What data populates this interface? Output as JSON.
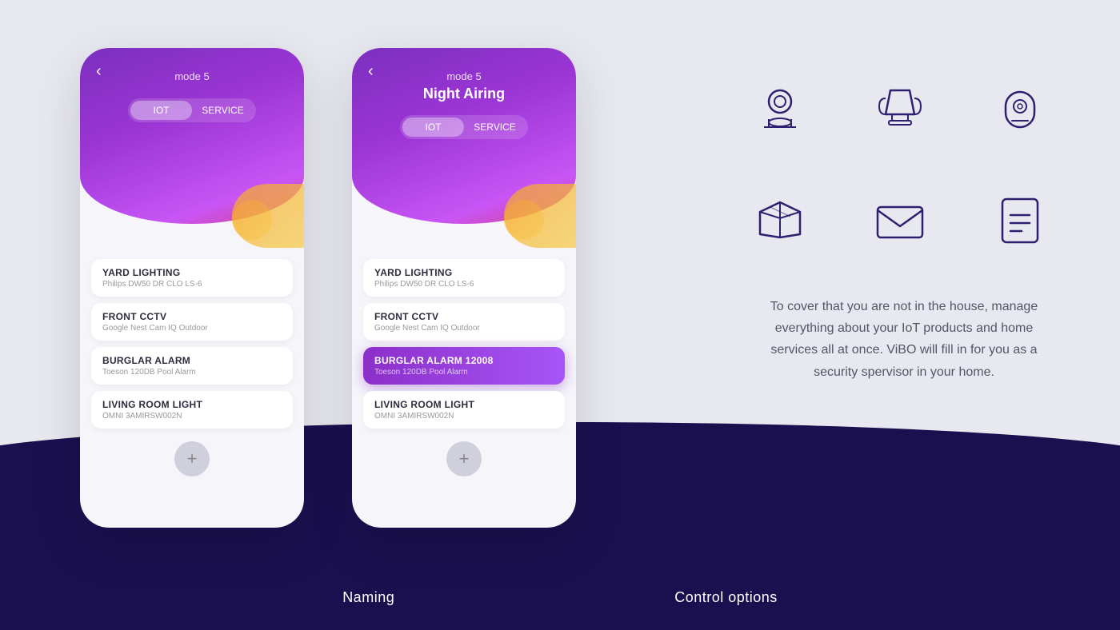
{
  "background_color": "#e8e8f0",
  "bottom_wave_color": "#1a1050",
  "phones": [
    {
      "id": "phone-naming",
      "mode_label": "mode 5",
      "mode_title": "",
      "tabs": [
        {
          "label": "IOT",
          "active": true
        },
        {
          "label": "SERVICE",
          "active": false
        }
      ],
      "devices": [
        {
          "name": "YARD LIGHTING",
          "model": "Philips DW50 DR CLO LS-6",
          "highlighted": false
        },
        {
          "name": "FRONT CCTV",
          "model": "Google Nest Cam IQ Outdoor",
          "highlighted": false
        },
        {
          "name": "BURGLAR ALARM",
          "model": "Toeson 120DB Pool Alarm",
          "highlighted": false
        },
        {
          "name": "LIVING ROOM LIGHT",
          "model": "OMNI 3AMIRSW002N",
          "highlighted": false
        }
      ],
      "add_btn": "+",
      "bottom_label": "Naming"
    },
    {
      "id": "phone-control",
      "mode_label": "mode 5",
      "mode_title": "Night Airing",
      "tabs": [
        {
          "label": "IOT",
          "active": true
        },
        {
          "label": "SERVICE",
          "active": false
        }
      ],
      "devices": [
        {
          "name": "YARD LIGHTING",
          "model": "Philips DW50 DR CLO LS-6",
          "highlighted": false
        },
        {
          "name": "FRONT CCTV",
          "model": "Google Nest Cam IQ Outdoor",
          "highlighted": false
        },
        {
          "name": "BURGLAR ALARM 12008",
          "model": "Toeson 120DB Pool Alarm",
          "highlighted": true
        },
        {
          "name": "LIVING ROOM LIGHT",
          "model": "OMNI 3AMIRSW002N",
          "highlighted": false
        }
      ],
      "add_btn": "+",
      "bottom_label": "Control options"
    }
  ],
  "description": "To cover that you are not in the house, manage everything about your IoT products and home services all at once. ViBO will fill in for you as a security spervisor in your home.",
  "icons": [
    {
      "name": "camera-icon",
      "type": "camera"
    },
    {
      "name": "lamp-icon",
      "type": "lamp"
    },
    {
      "name": "speaker-icon",
      "type": "speaker"
    },
    {
      "name": "box-icon",
      "type": "box"
    },
    {
      "name": "mail-icon",
      "type": "mail"
    },
    {
      "name": "document-icon",
      "type": "document"
    }
  ]
}
